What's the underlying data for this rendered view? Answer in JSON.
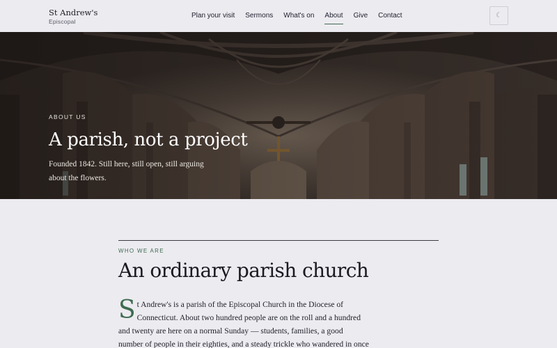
{
  "brand": {
    "name": "St Andrew's",
    "subtitle": "Episcopal"
  },
  "nav": {
    "items": [
      {
        "label": "Plan your visit"
      },
      {
        "label": "Sermons"
      },
      {
        "label": "What's on"
      },
      {
        "label": "About",
        "active": true
      },
      {
        "label": "Give"
      },
      {
        "label": "Contact"
      }
    ]
  },
  "theme_toggle": {
    "icon": "moon-icon",
    "glyph": "☾"
  },
  "hero": {
    "eyebrow": "ABOUT US",
    "title": "A parish, not a project",
    "text": "Founded 1842. Still here, still open, still arguing about the flowers."
  },
  "section": {
    "eyebrow": "WHO WE ARE",
    "title": "An ordinary parish church",
    "dropcap": "S",
    "body": "t Andrew's is a parish of the Episcopal Church in the Diocese of Connecticut. About two hundred people are on the roll and a hundred and twenty are here on a normal Sunday — students, families, a good number of people in their eighties, and a steady trickle who wandered in once and stayed."
  },
  "colors": {
    "accent": "#3e6b50",
    "background": "#ecebf0",
    "text": "#1c1c24"
  }
}
